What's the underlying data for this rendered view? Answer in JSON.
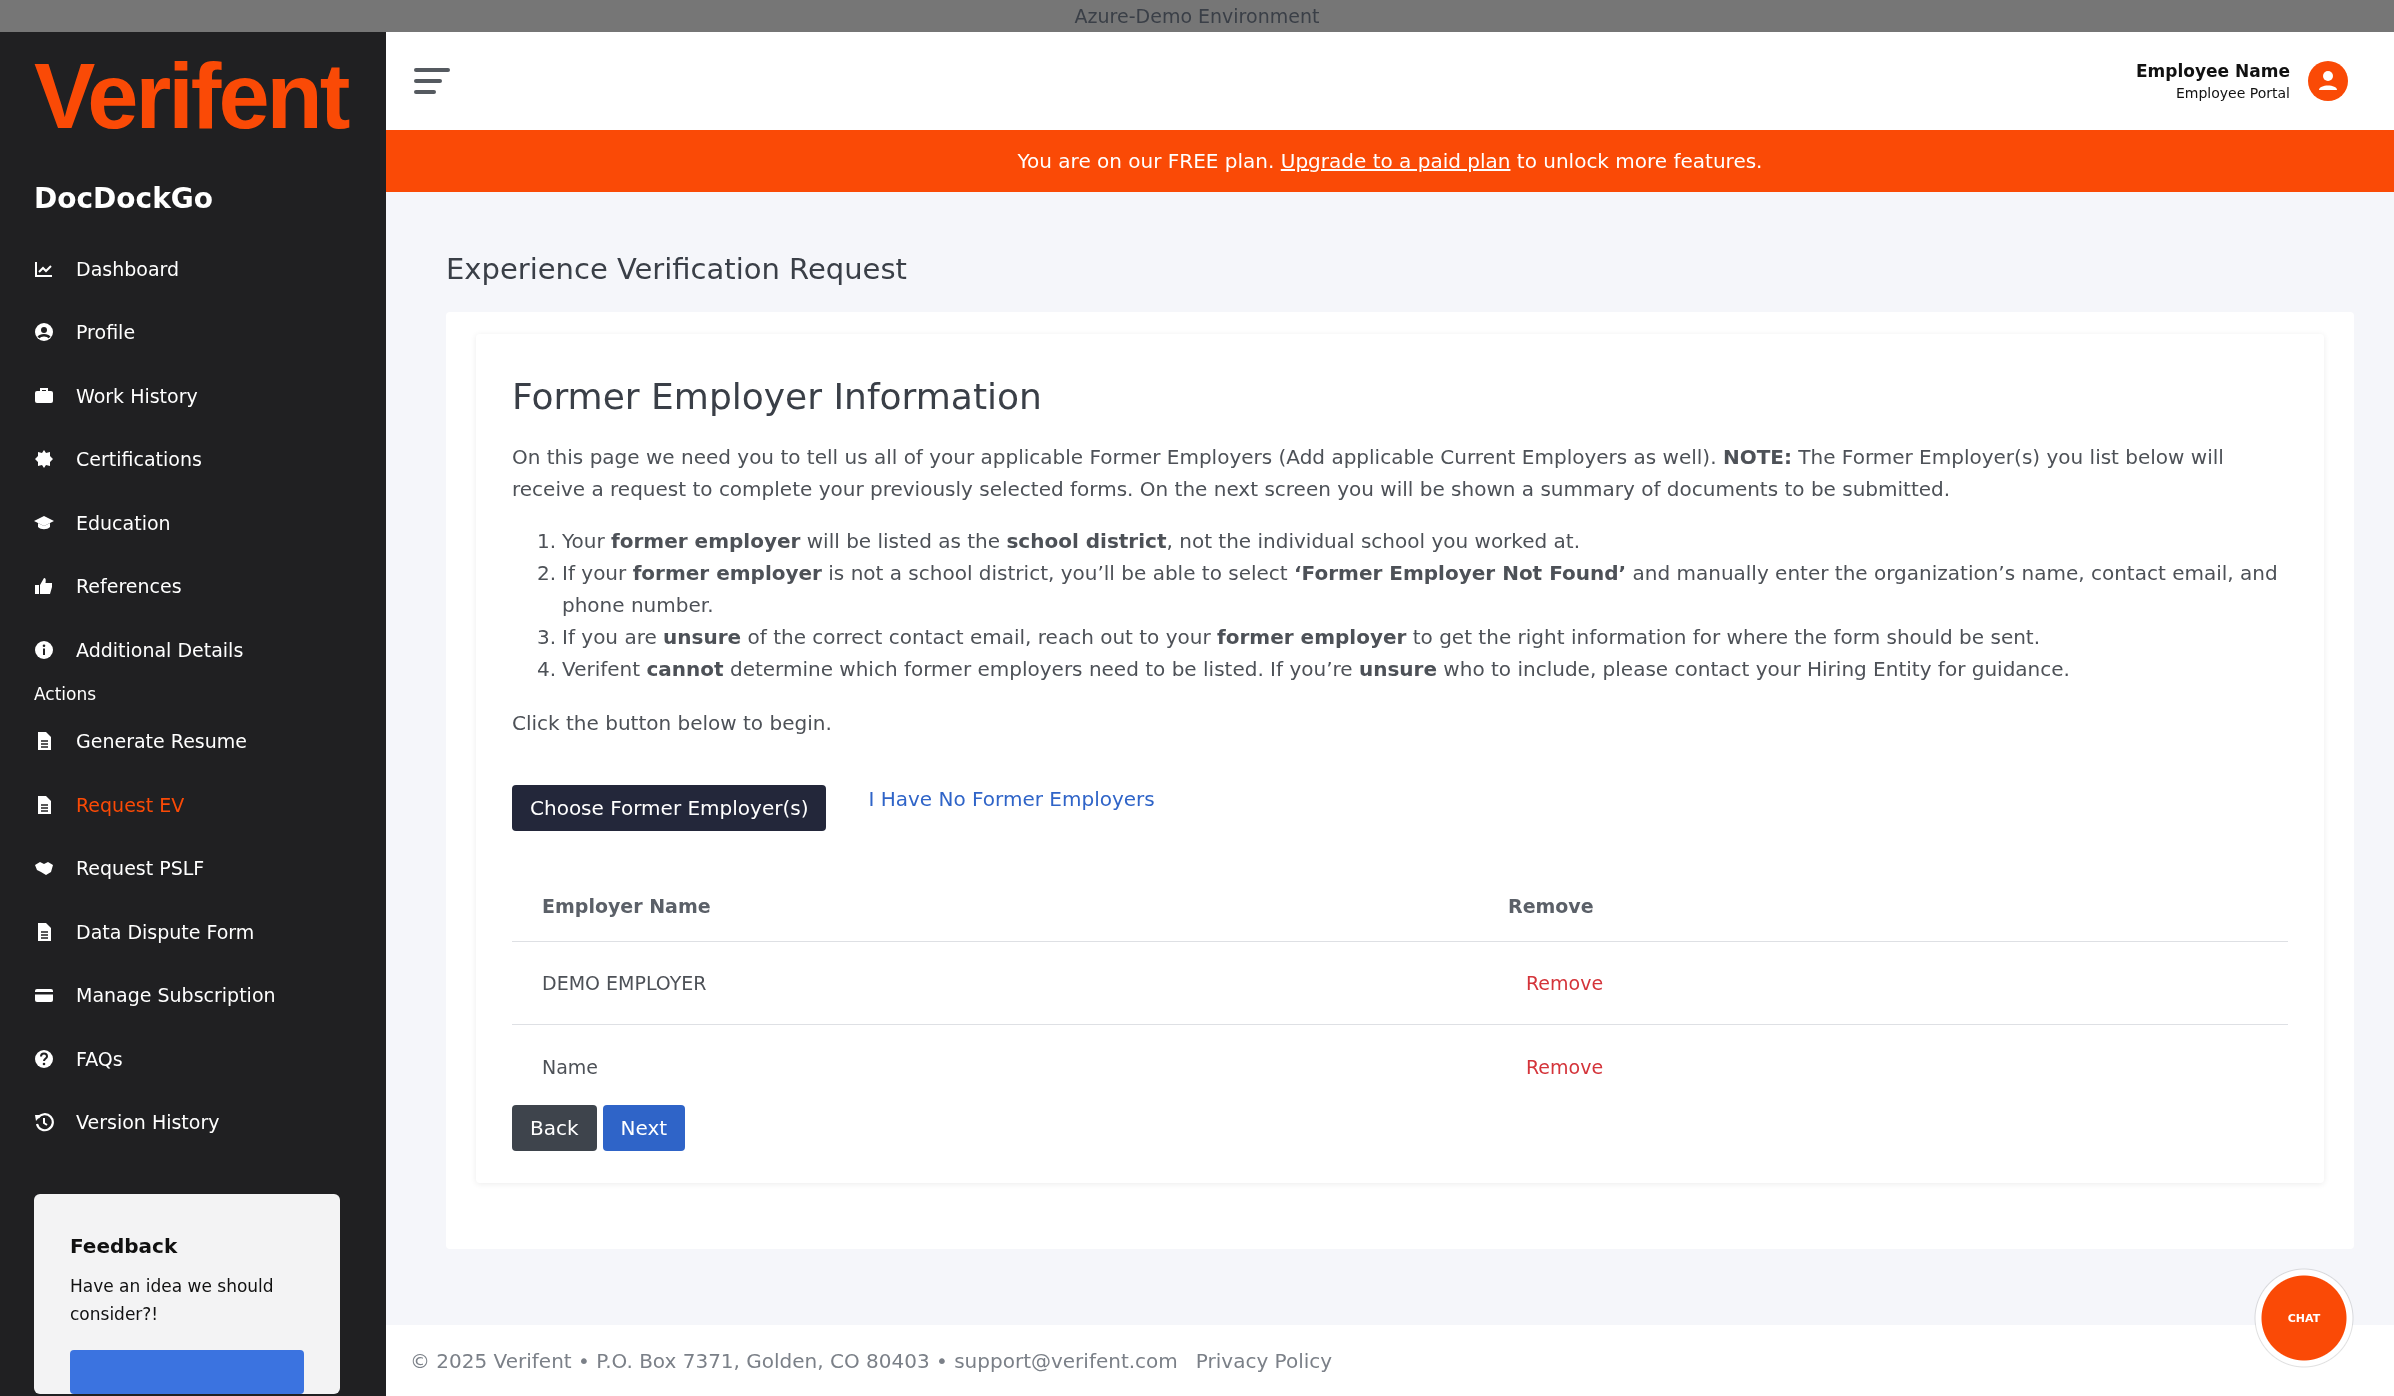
{
  "environment_bar": {
    "title": "Azure-Demo Environment"
  },
  "sidebar": {
    "logo": "Verifent",
    "app_name": "DocDockGo",
    "items": [
      {
        "label": "Dashboard",
        "selected": false
      },
      {
        "label": "Profile",
        "selected": false
      },
      {
        "label": "Work History",
        "selected": false
      },
      {
        "label": "Certifications",
        "selected": false
      },
      {
        "label": "Education",
        "selected": false
      },
      {
        "label": "References",
        "selected": false
      },
      {
        "label": "Additional Details",
        "selected": false
      }
    ],
    "section_title": "Actions",
    "actions": [
      {
        "label": "Generate Resume",
        "selected": false
      },
      {
        "label": "Request EV",
        "selected": true
      },
      {
        "label": "Request PSLF",
        "selected": false
      },
      {
        "label": "Data Dispute Form",
        "selected": false
      },
      {
        "label": "Manage Subscription",
        "selected": false
      },
      {
        "label": "FAQs",
        "selected": false
      },
      {
        "label": "Version History",
        "selected": false
      }
    ],
    "feedback": {
      "title": "Feedback",
      "text": "Have an idea we should consider?!"
    }
  },
  "header": {
    "user_name": "Employee Name",
    "user_role": "Employee Portal"
  },
  "banner": {
    "before": "You are on our FREE plan.",
    "link": "Upgrade to a paid plan",
    "after": "to unlock more features."
  },
  "page_title": "Experience Verification Request",
  "card": {
    "heading": "Former Employer Information",
    "intro": "On this page we need you to tell us all of your applicable Former Employers (Add applicable Current Employers as well). **NOTE:** The Former Employer(s) you list below will receive a request to complete your previously selected forms. On the next screen you will be shown a summary of documents to be submitted.",
    "steps": [
      {
        "number": "1.",
        "text": "Your **former employer** will be listed as the **school district**, not the individual school you worked at."
      },
      {
        "number": "2.",
        "text": "If your **former employer** is not a school district, you’ll be able to select **‘Former Employer Not Found’** and manually enter the organization’s name, contact email, and phone number."
      },
      {
        "number": "3.",
        "text": "If you are **unsure** of the correct contact email, reach out to your **former employer** to get the right information for where the form should be sent."
      },
      {
        "number": "4.",
        "text": "Verifent **cannot** determine which former employers need to be listed. If you’re **unsure** who to include, please contact your Hiring Entity for guidance."
      }
    ],
    "prompt": "Click the button below to begin.",
    "choose_button": "Choose Former Employer(s)",
    "no_employers_link": "I Have No Former Employers",
    "table": {
      "columns": [
        "Employer Name",
        "Remove"
      ],
      "rows": [
        {
          "employer": "DEMO EMPLOYER",
          "action": "Remove"
        },
        {
          "employer": "Name",
          "action": "Remove"
        }
      ]
    },
    "buttons": [
      {
        "label": "Back",
        "kind": "secondary"
      },
      {
        "label": "Next",
        "kind": "primary"
      }
    ]
  },
  "chat": {
    "label": "CHAT"
  },
  "footer": {
    "text": "© 2025 Verifent • P.O. Box 7371, Golden, CO 80403 • support@verifent.com",
    "link": "Privacy Policy"
  }
}
